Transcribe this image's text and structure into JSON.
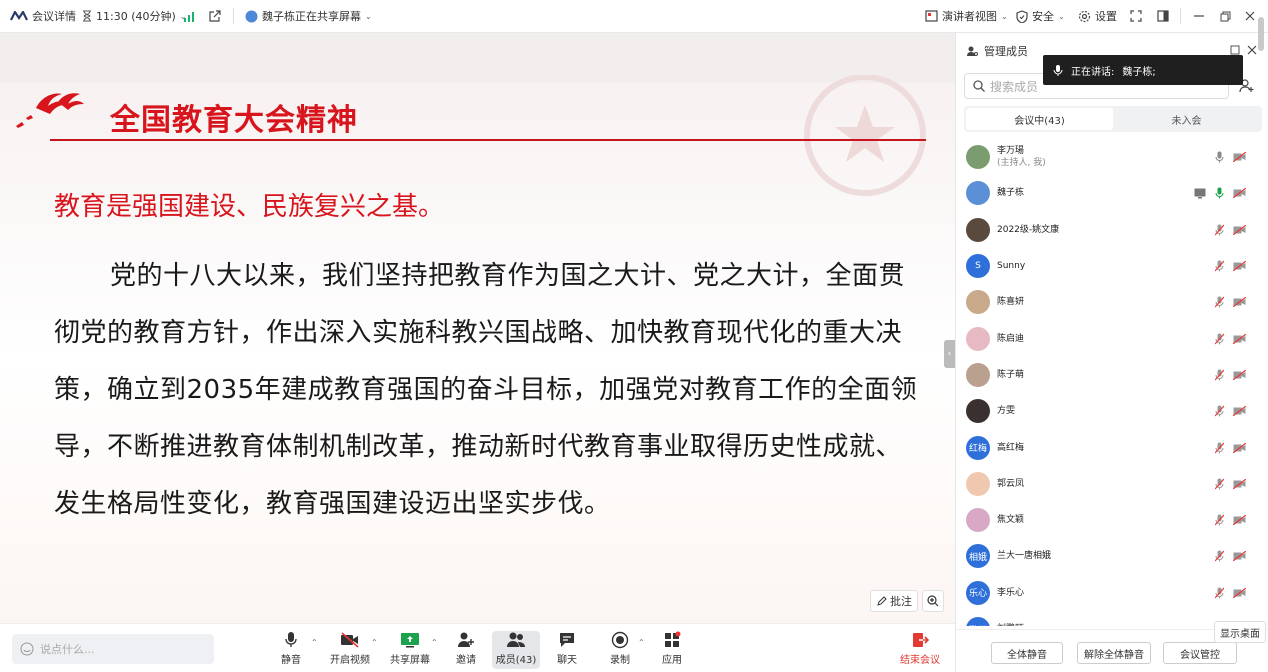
{
  "topbar": {
    "meeting_details": "会议详情",
    "time": "11:30 (40分钟)",
    "sharing": "魏子栋正在共享屏幕",
    "speaker_view": "演讲者视图",
    "security": "安全",
    "settings": "设置"
  },
  "slide": {
    "title": "全国教育大会精神",
    "subtitle": "教育是强国建设、民族复兴之基。",
    "body": "党的十八大以来，我们坚持把教育作为国之大计、党之大计，全面贯彻党的教育方针，作出深入实施科教兴国战略、加快教育现代化的重大决策，确立到2035年建成教育强国的奋斗目标，加强党对教育工作的全面领导，不断推进教育体制机制改革，推动新时代教育事业取得历史性成就、发生格局性变化，教育强国建设迈出坚实步伐。",
    "annotate": "批注"
  },
  "bottombar": {
    "chat_placeholder": "说点什么...",
    "mute": "静音",
    "video": "开启视频",
    "share": "共享屏幕",
    "invite": "邀请",
    "members": "成员(43)",
    "chat": "聊天",
    "record": "录制",
    "apps": "应用",
    "end": "结束会议"
  },
  "panel": {
    "title": "管理成员",
    "speaking_label": "正在讲话:",
    "speaking_name": "魏子栋;",
    "search_placeholder": "搜索成员",
    "tab_in": "会议中(43)",
    "tab_out": "未入会",
    "members": [
      {
        "name": "李万瑒",
        "sub": "(主持人, 我)",
        "avatar_text": "",
        "color": "#7a9c6e",
        "screen": false,
        "mic_on": true
      },
      {
        "name": "魏子栋",
        "sub": "",
        "avatar_text": "",
        "color": "#5b8fd6",
        "screen": true,
        "mic_on": true
      },
      {
        "name": "2022级-姚文康",
        "sub": "",
        "avatar_text": "",
        "color": "#5a4a3e",
        "screen": false,
        "mic_on": false
      },
      {
        "name": "Sunny",
        "sub": "",
        "avatar_text": "S",
        "color": "#2f6fd9",
        "screen": false,
        "mic_on": false
      },
      {
        "name": "陈喜妍",
        "sub": "",
        "avatar_text": "",
        "color": "#c8a98a",
        "screen": false,
        "mic_on": false
      },
      {
        "name": "陈启迪",
        "sub": "",
        "avatar_text": "",
        "color": "#e7b9c2",
        "screen": false,
        "mic_on": false
      },
      {
        "name": "陈子萌",
        "sub": "",
        "avatar_text": "",
        "color": "#b9a08f",
        "screen": false,
        "mic_on": false
      },
      {
        "name": "方雯",
        "sub": "",
        "avatar_text": "",
        "color": "#3b3030",
        "screen": false,
        "mic_on": false
      },
      {
        "name": "高红梅",
        "sub": "",
        "avatar_text": "红梅",
        "color": "#2f6fd9",
        "screen": false,
        "mic_on": false
      },
      {
        "name": "郭云凤",
        "sub": "",
        "avatar_text": "",
        "color": "#f0c8b0",
        "screen": false,
        "mic_on": false
      },
      {
        "name": "焦文颖",
        "sub": "",
        "avatar_text": "",
        "color": "#d8a8c4",
        "screen": false,
        "mic_on": false
      },
      {
        "name": "兰大一唐相娥",
        "sub": "",
        "avatar_text": "相娥",
        "color": "#2f6fd9",
        "screen": false,
        "mic_on": false
      },
      {
        "name": "李乐心",
        "sub": "",
        "avatar_text": "乐心",
        "color": "#2f6fd9",
        "screen": false,
        "mic_on": false
      },
      {
        "name": "刘鹏旺",
        "sub": "",
        "avatar_text": "鹏旺",
        "color": "#2f6fd9",
        "screen": false,
        "mic_on": false
      }
    ],
    "mute_all": "全体静音",
    "unmute_all": "解除全体静音",
    "controls": "会议管控",
    "show_desktop": "显示桌面"
  }
}
